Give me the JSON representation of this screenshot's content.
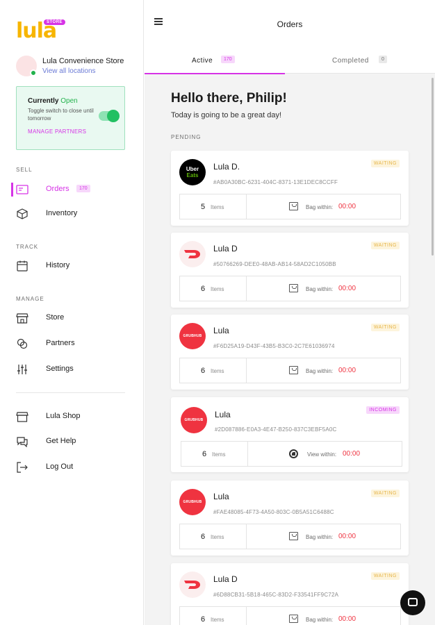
{
  "app": {
    "logo_text": "lula",
    "logo_badge": "STORE"
  },
  "store": {
    "name": "Lula Convenience Store",
    "link": "View all locations"
  },
  "status": {
    "title_prefix": "Currently",
    "state": "Open",
    "subtitle": "Toggle switch to close until tomorrow",
    "manage_partners": "MANAGE PARTNERS",
    "toggle_on": true
  },
  "sidebar": {
    "sell_label": "SELL",
    "track_label": "TRACK",
    "manage_label": "MANAGE",
    "items": [
      {
        "label": "Orders",
        "badge": "170",
        "icon": "orders-icon"
      },
      {
        "label": "Inventory",
        "icon": "box-icon"
      },
      {
        "label": "History",
        "icon": "calendar-icon"
      },
      {
        "label": "Store",
        "icon": "store-icon"
      },
      {
        "label": "Partners",
        "icon": "partners-icon"
      },
      {
        "label": "Settings",
        "icon": "sliders-icon"
      },
      {
        "label": "Lula Shop",
        "icon": "shop-icon"
      },
      {
        "label": "Get Help",
        "icon": "help-chat-icon"
      },
      {
        "label": "Log Out",
        "icon": "logout-icon"
      }
    ]
  },
  "header": {
    "title": "Orders"
  },
  "tabs": [
    {
      "label": "Active",
      "badge": "170"
    },
    {
      "label": "Completed",
      "badge": "0"
    }
  ],
  "main": {
    "greeting": "Hello there, Philip!",
    "subtitle": "Today is going to be a great day!",
    "pending_label": "PENDING"
  },
  "orders": [
    {
      "brand": "Uber Eats",
      "customer": "Lula D.",
      "id": "#AB0A30BC-6231-404C-8371-13E1DEC8CCFF",
      "status": "WAITING",
      "items": "5",
      "items_label": "Items",
      "within_label": "Bag within:",
      "time": "00:00"
    },
    {
      "brand": "DoorDash",
      "customer": "Lula D",
      "id": "#50766269-DEE0-48AB-AB14-58AD2C1050BB",
      "status": "WAITING",
      "items": "6",
      "items_label": "Items",
      "within_label": "Bag within:",
      "time": "00:00"
    },
    {
      "brand": "Grubhub",
      "customer": "Lula",
      "id": "#F6D25A19-D43F-43B5-B3C0-2C7E61036974",
      "status": "WAITING",
      "items": "6",
      "items_label": "Items",
      "within_label": "Bag within:",
      "time": "00:00"
    },
    {
      "brand": "Grubhub",
      "customer": "Lula",
      "id": "#2D087886-E0A3-4E47-B250-837C3EBF5A0C",
      "status": "INCOMING",
      "items": "6",
      "items_label": "Items",
      "within_label": "View within:",
      "time": "00:00"
    },
    {
      "brand": "Grubhub",
      "customer": "Lula",
      "id": "#FAE48085-4F73-4A50-803C-0B5A51C6488C",
      "status": "WAITING",
      "items": "6",
      "items_label": "Items",
      "within_label": "Bag within:",
      "time": "00:00"
    },
    {
      "brand": "DoorDash",
      "customer": "Lula D",
      "id": "#6D88CB31-5B18-465C-83D2-F33541FF9C72A",
      "status": "WAITING",
      "items": "6",
      "items_label": "Items",
      "within_label": "Bag within:",
      "time": "00:00"
    }
  ],
  "brands": {
    "uber_line1": "Uber",
    "uber_line2": "Eats",
    "grubhub_text": "GRUBHUB"
  },
  "colors": {
    "accent": "#d633e6",
    "brand_yellow": "#f7b500",
    "open_green": "#22b24c",
    "timer_red": "#ef3340"
  }
}
